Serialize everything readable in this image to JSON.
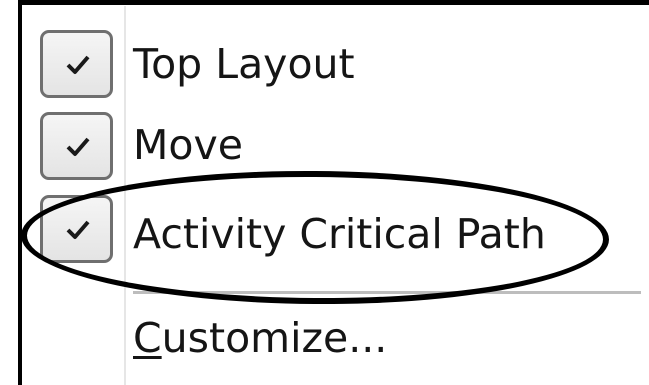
{
  "menu": {
    "items": [
      {
        "label": "Top Layout",
        "checked": true
      },
      {
        "label": "Move",
        "checked": true
      },
      {
        "label": "Activity Critical Path",
        "checked": true
      }
    ],
    "customize": {
      "accelerator": "C",
      "rest": "ustomize..."
    }
  },
  "annotation": {
    "shape": "oval",
    "color": "#000000",
    "target": "Activity Critical Path"
  },
  "icons": {
    "check": "checkmark-icon"
  }
}
